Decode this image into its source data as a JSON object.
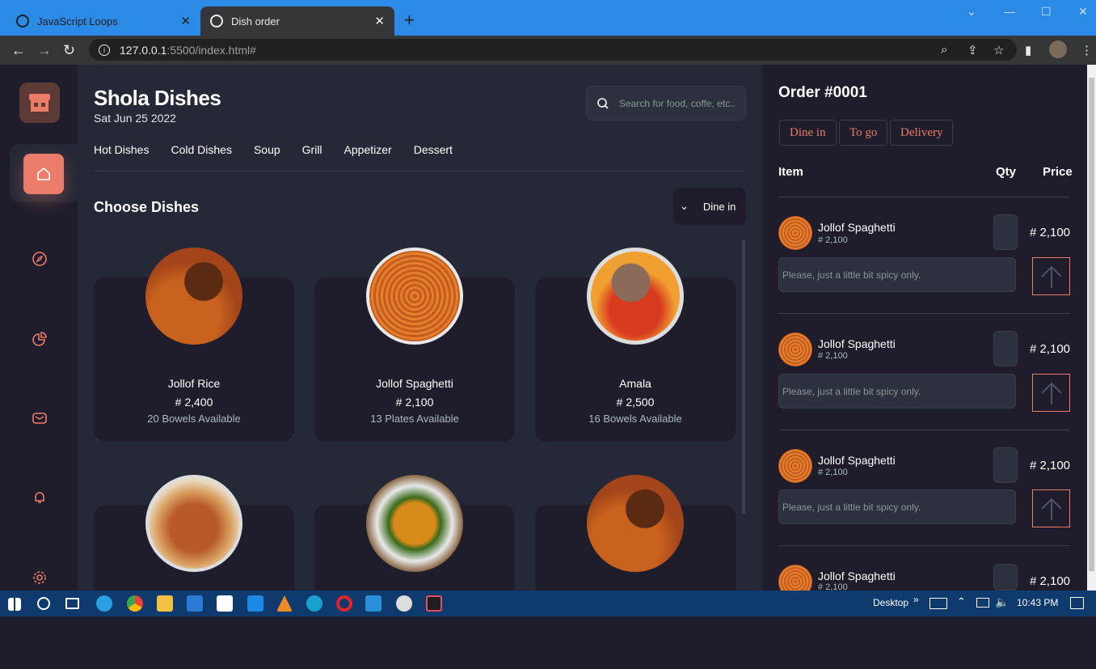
{
  "browser": {
    "tabs": [
      {
        "label": "JavaScript Loops",
        "close": "✕"
      },
      {
        "label": "Dish order",
        "close": "✕"
      }
    ],
    "new_tab": "+",
    "url_host": "127.0.0.1",
    "url_path": ":5500/index.html#",
    "window": {
      "minimize": "—",
      "maximize": "☐",
      "close": "✕"
    }
  },
  "header": {
    "title": "Shola Dishes",
    "date": "Sat Jun 25 2022",
    "search_placeholder": "Search for food, coffe, etc.."
  },
  "categories": [
    "Hot Dishes",
    "Cold Dishes",
    "Soup",
    "Grill",
    "Appetizer",
    "Dessert"
  ],
  "section": {
    "title": "Choose Dishes",
    "dine_option": "Dine in"
  },
  "dishes": [
    {
      "name": "Jollof Rice",
      "price": "# 2,400",
      "availability": "20 Bowels Available"
    },
    {
      "name": "Jollof Spaghetti",
      "price": "# 2,100",
      "availability": "13 Plates Available"
    },
    {
      "name": "Amala",
      "price": "# 2,500",
      "availability": "16 Bowels Available"
    }
  ],
  "order": {
    "title": "Order #0001",
    "types": [
      "Dine in",
      "To go",
      "Delivery"
    ],
    "headers": {
      "item": "Item",
      "qty": "Qty",
      "price": "Price"
    },
    "items": [
      {
        "name": "Jollof Spaghetti",
        "unit_price": "# 2,100",
        "price": "# 2,100",
        "note_placeholder": "Please, just a little bit spicy only."
      },
      {
        "name": "Jollof Spaghetti",
        "unit_price": "# 2,100",
        "price": "# 2,100",
        "note_placeholder": "Please, just a little bit spicy only."
      },
      {
        "name": "Jollof Spaghetti",
        "unit_price": "# 2,100",
        "price": "# 2,100",
        "note_placeholder": "Please, just a little bit spicy only."
      },
      {
        "name": "Jollof Spaghetti",
        "unit_price": "# 2,100",
        "price": "# 2,100"
      }
    ]
  },
  "taskbar": {
    "desktop": "Desktop",
    "time": "10:43 PM"
  },
  "colors": {
    "accent": "#ea7c69",
    "panel": "#1f1d2b",
    "bg": "#252836"
  }
}
